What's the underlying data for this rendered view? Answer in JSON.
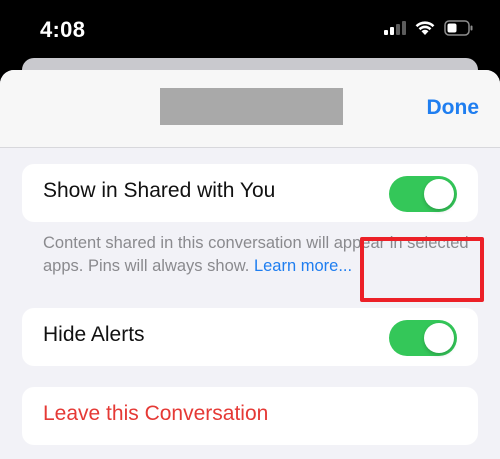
{
  "status_bar": {
    "time": "4:08",
    "signal_icon": "cellular-signal-icon",
    "wifi_icon": "wifi-icon",
    "battery_icon": "battery-icon"
  },
  "header": {
    "title": "",
    "title_redacted": true,
    "done_label": "Done"
  },
  "settings": {
    "show_in_shared": {
      "label": "Show in Shared with You",
      "enabled": true
    },
    "footnote": {
      "text": "Content shared in this conversation will appear in selected apps. Pins will always show. ",
      "link": "Learn more..."
    },
    "hide_alerts": {
      "label": "Hide Alerts",
      "enabled": true
    },
    "leave": {
      "label": "Leave this Conversation"
    }
  },
  "colors": {
    "accent": "#1f7ef0",
    "toggle_on": "#34c759",
    "destructive": "#e53935",
    "highlight": "#ec2027"
  }
}
